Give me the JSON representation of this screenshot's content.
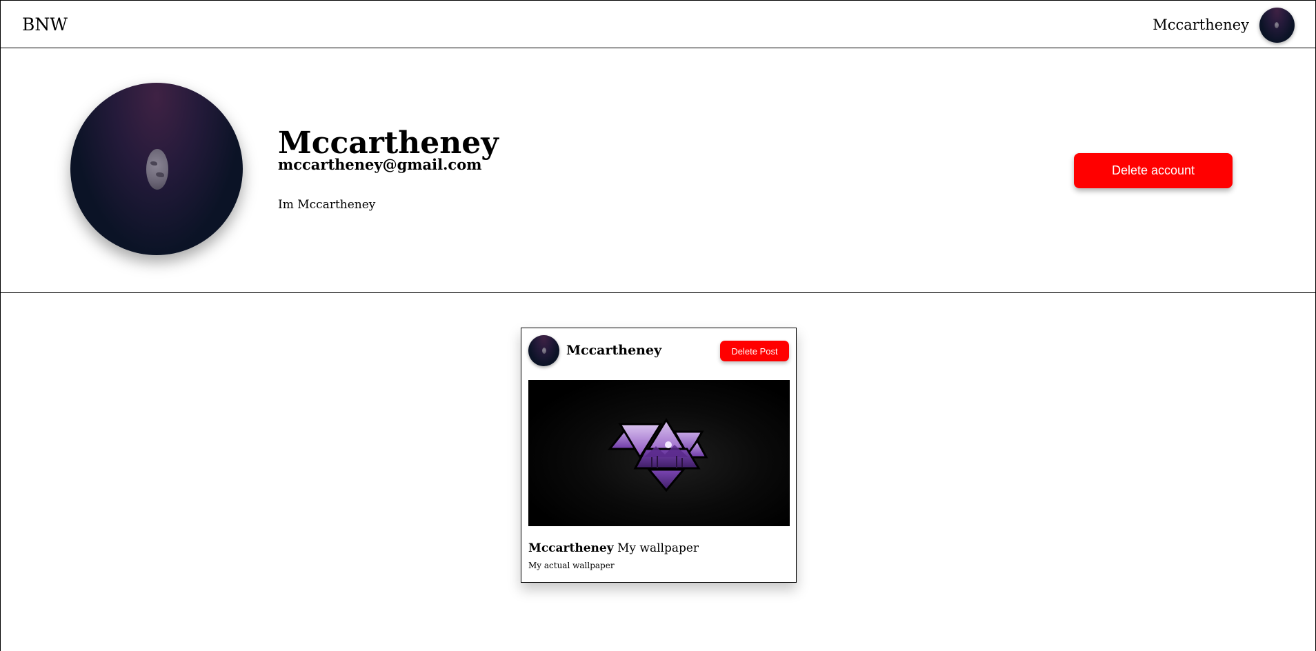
{
  "navbar": {
    "brand": "BNW",
    "username": "Mccartheney",
    "avatar_icon": "moon-night-avatar"
  },
  "profile": {
    "name": "Mccartheney",
    "email": "mccartheney@gmail.com",
    "bio": "Im Mccartheney",
    "avatar_icon": "moon-night-avatar",
    "delete_account_label": "Delete account"
  },
  "posts": [
    {
      "author": "Mccartheney",
      "delete_label": "Delete Post",
      "image_icon": "purple-triangles-wallpaper",
      "title": "My wallpaper",
      "description": "My actual wallpaper"
    }
  ],
  "colors": {
    "danger": "#ff0000",
    "border": "#000000",
    "background": "#ffffff"
  }
}
